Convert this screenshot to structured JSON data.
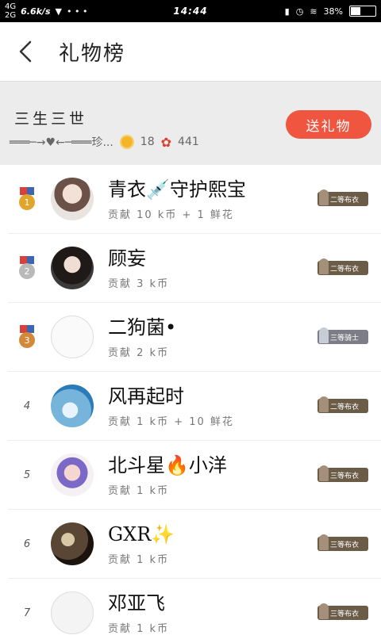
{
  "status_bar": {
    "network_top": "4G",
    "network_bottom": "2G",
    "speed": "6.6k/s",
    "extra": "• • •",
    "time": "14:44",
    "battery": "38%"
  },
  "nav": {
    "title": "礼物榜",
    "back_icon": "chevron-left-icon"
  },
  "header": {
    "name": "三生三世",
    "relation": "═══─→♥←─═══珍...",
    "coins": "18",
    "flowers": "441",
    "send_label": "送礼物",
    "send_color": "#f0553f"
  },
  "rows": [
    {
      "rank": "1",
      "name": "青衣💉守护熙宝",
      "contribution": "贡献 10 k币 + 1 鲜花",
      "badge": "二等布衣",
      "medal_color": "#e2a52c"
    },
    {
      "rank": "2",
      "name": "顾妄",
      "contribution": "贡献 3 k币",
      "badge": "二等布衣",
      "medal_color": "#b9b9b9"
    },
    {
      "rank": "3",
      "name": "二狗菌•",
      "contribution": "贡献 2 k币",
      "badge": "三等骑士",
      "medal_color": "#d28a3a"
    },
    {
      "rank": "4",
      "name": "风再起时",
      "contribution": "贡献 1 k币 + 10 鲜花",
      "badge": "二等布衣"
    },
    {
      "rank": "5",
      "name": "北斗星🔥小洋",
      "contribution": "贡献 1 k币",
      "badge": "三等布衣"
    },
    {
      "rank": "6",
      "name": "GXR✨",
      "contribution": "贡献 1 k币",
      "badge": "三等布衣"
    },
    {
      "rank": "7",
      "name": "邓亚飞",
      "contribution": "贡献 1 k币",
      "badge": "三等布衣"
    }
  ]
}
